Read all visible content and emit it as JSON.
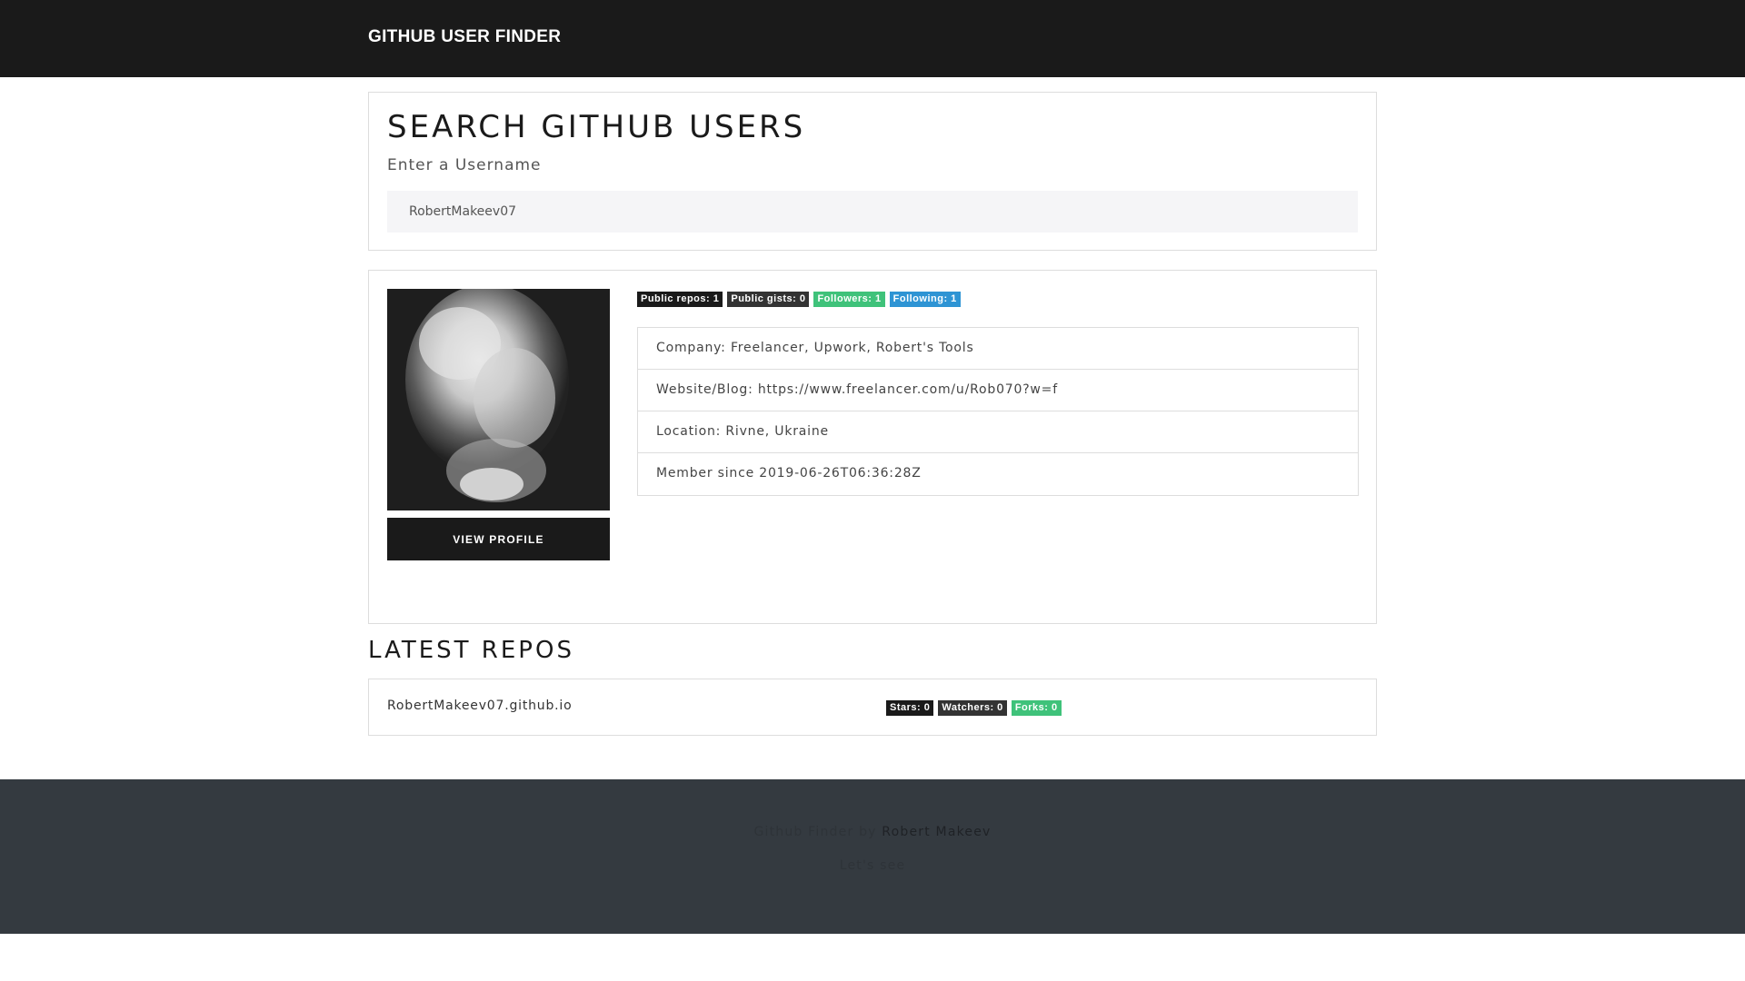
{
  "navbar": {
    "brand": "GITHUB USER FINDER"
  },
  "search": {
    "title": "SEARCH GITHUB USERS",
    "subtitle": "Enter a Username",
    "value": "RobertMakeev07"
  },
  "profile": {
    "avatar_description": "smoke-portrait-avatar",
    "view_button_label": "VIEW PROFILE",
    "badges": {
      "repos": "Public repos: 1",
      "gists": "Public gists: 0",
      "followers": "Followers: 1",
      "following": "Following: 1"
    },
    "info": {
      "company": "Company: Freelancer, Upwork, Robert's Tools",
      "website": "Website/Blog: https://www.freelancer.com/u/Rob070?w=f",
      "location": "Location: Rivne, Ukraine",
      "member_since": "Member since 2019-06-26T06:36:28Z"
    }
  },
  "repos": {
    "title": "LATEST REPOS",
    "items": [
      {
        "name": "RobertMakeev07.github.io",
        "stars": "Stars: 0",
        "watchers": "Watchers: 0",
        "forks": "Forks: 0"
      }
    ]
  },
  "footer": {
    "prefix": "Github Finder by ",
    "author": "Robert Makeev",
    "tagline": "Let's see"
  },
  "colors": {
    "navbar": "#1a1a1a",
    "badge_dark": "#1a1a1a",
    "badge_grey": "#333333",
    "badge_green": "#3fc27a",
    "badge_blue": "#2e94d4",
    "footer": "#343a40"
  }
}
